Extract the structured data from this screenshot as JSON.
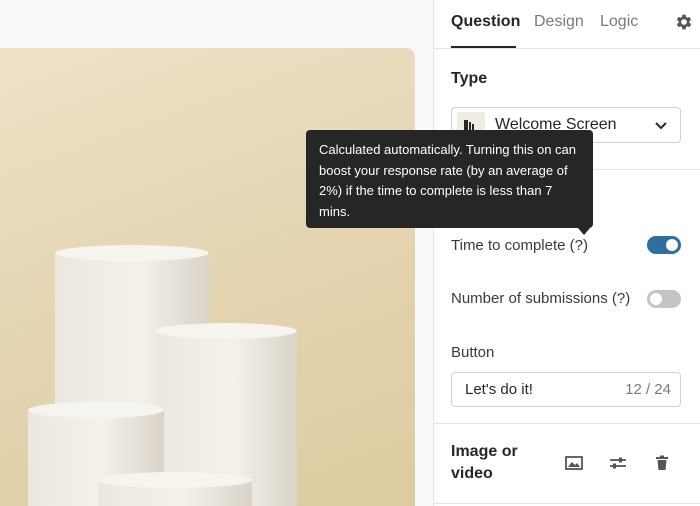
{
  "tabs": [
    {
      "label": "Question",
      "active": true
    },
    {
      "label": "Design",
      "active": false
    },
    {
      "label": "Logic",
      "active": false
    }
  ],
  "type_section": {
    "label": "Type",
    "selected": "Welcome Screen"
  },
  "settings": {
    "time_to_complete": {
      "label": "Time to complete (?)",
      "enabled": true
    },
    "number_of_submissions": {
      "label": "Number of submissions (?)",
      "enabled": false
    }
  },
  "button_section": {
    "label": "Button",
    "value": "Let's do it!",
    "counter": "12 / 24"
  },
  "media_section": {
    "label": "Image or video",
    "icons": [
      "image-icon",
      "sliders-icon",
      "trash-icon"
    ]
  },
  "tooltip": {
    "text": "Calculated automatically. Turning this on can boost your response rate (by an average of 2%) if the time to complete is less than 7 mins."
  },
  "colors": {
    "toggle_on": "#2e6fa0",
    "toggle_off": "#c4c4c4",
    "tooltip_bg": "#262627",
    "image_bg": "#e3d3af"
  }
}
